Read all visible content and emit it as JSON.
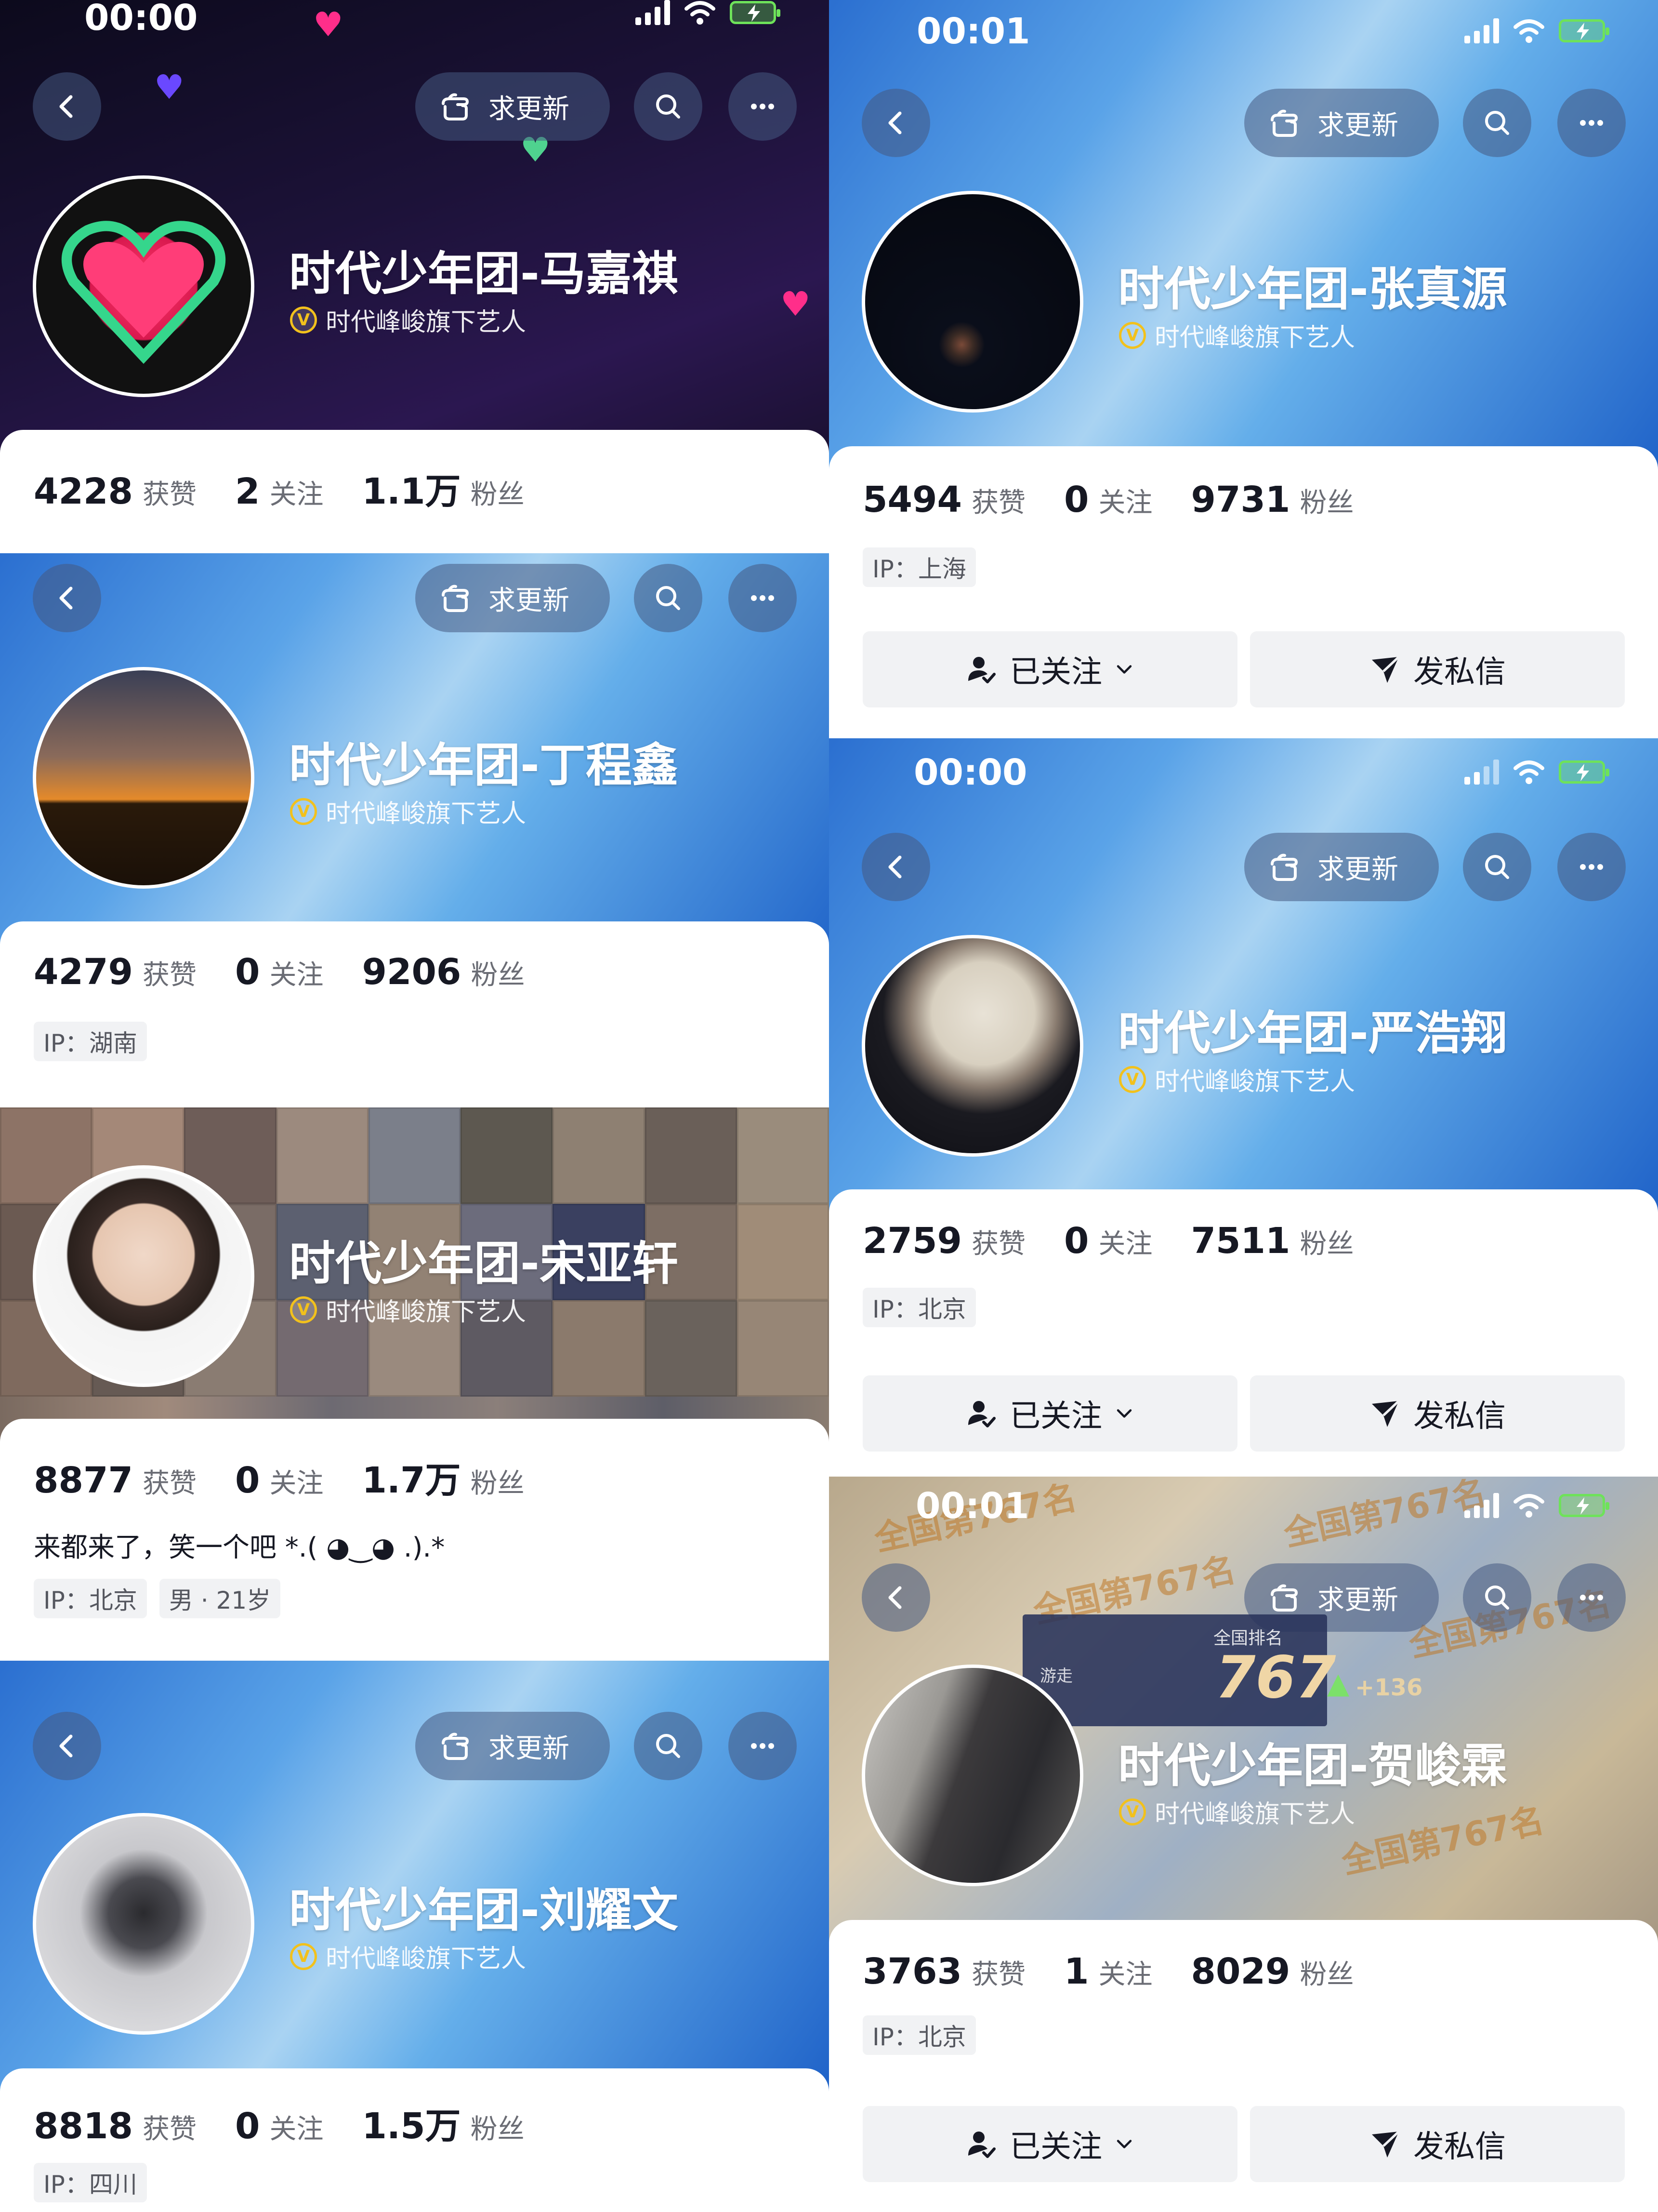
{
  "common": {
    "request_update_label": "求更新",
    "verify_text": "时代峰峻旗下艺人",
    "verify_badge": "V",
    "likes_label": "获赞",
    "following_label": "关注",
    "fans_label": "粉丝",
    "followed_label": "已关注",
    "message_label": "发私信"
  },
  "left_column": [
    {
      "status_time": "00:00",
      "name": "时代少年团-马嘉祺",
      "likes": "4228",
      "following": "2",
      "fans": "1.1万"
    },
    {
      "name": "时代少年团-丁程鑫",
      "likes": "4279",
      "following": "0",
      "fans": "9206",
      "ip": "IP：湖南"
    },
    {
      "name": "时代少年团-宋亚轩",
      "likes": "8877",
      "following": "0",
      "fans": "1.7万",
      "bio": "来都来了，笑一个吧 *.( ◕‿◕ .).*",
      "ip": "IP：北京",
      "gender_age": "男 · 21岁"
    },
    {
      "name": "时代少年团-刘耀文",
      "likes": "8818",
      "following": "0",
      "fans": "1.5万",
      "ip": "IP：四川"
    }
  ],
  "right_column": [
    {
      "status_time": "00:01",
      "name": "时代少年团-张真源",
      "likes": "5494",
      "following": "0",
      "fans": "9731",
      "ip": "IP：上海"
    },
    {
      "status_time": "00:00",
      "name": "时代少年团-严浩翔",
      "likes": "2759",
      "following": "0",
      "fans": "7511",
      "ip": "IP：北京"
    },
    {
      "status_time": "00:01",
      "name": "时代少年团-贺峻霖",
      "likes": "3763",
      "following": "1",
      "fans": "8029",
      "ip": "IP：北京",
      "rank_title": "全国排名",
      "rank_value": "767",
      "rank_delta": "+136",
      "rank_side": "游走",
      "rank_bg_text": "全国第767名"
    }
  ],
  "colors": {
    "verify_gold": "#f2c11c",
    "battery_green": "#6ee25a",
    "accent_pink": "#ff2e8a"
  }
}
